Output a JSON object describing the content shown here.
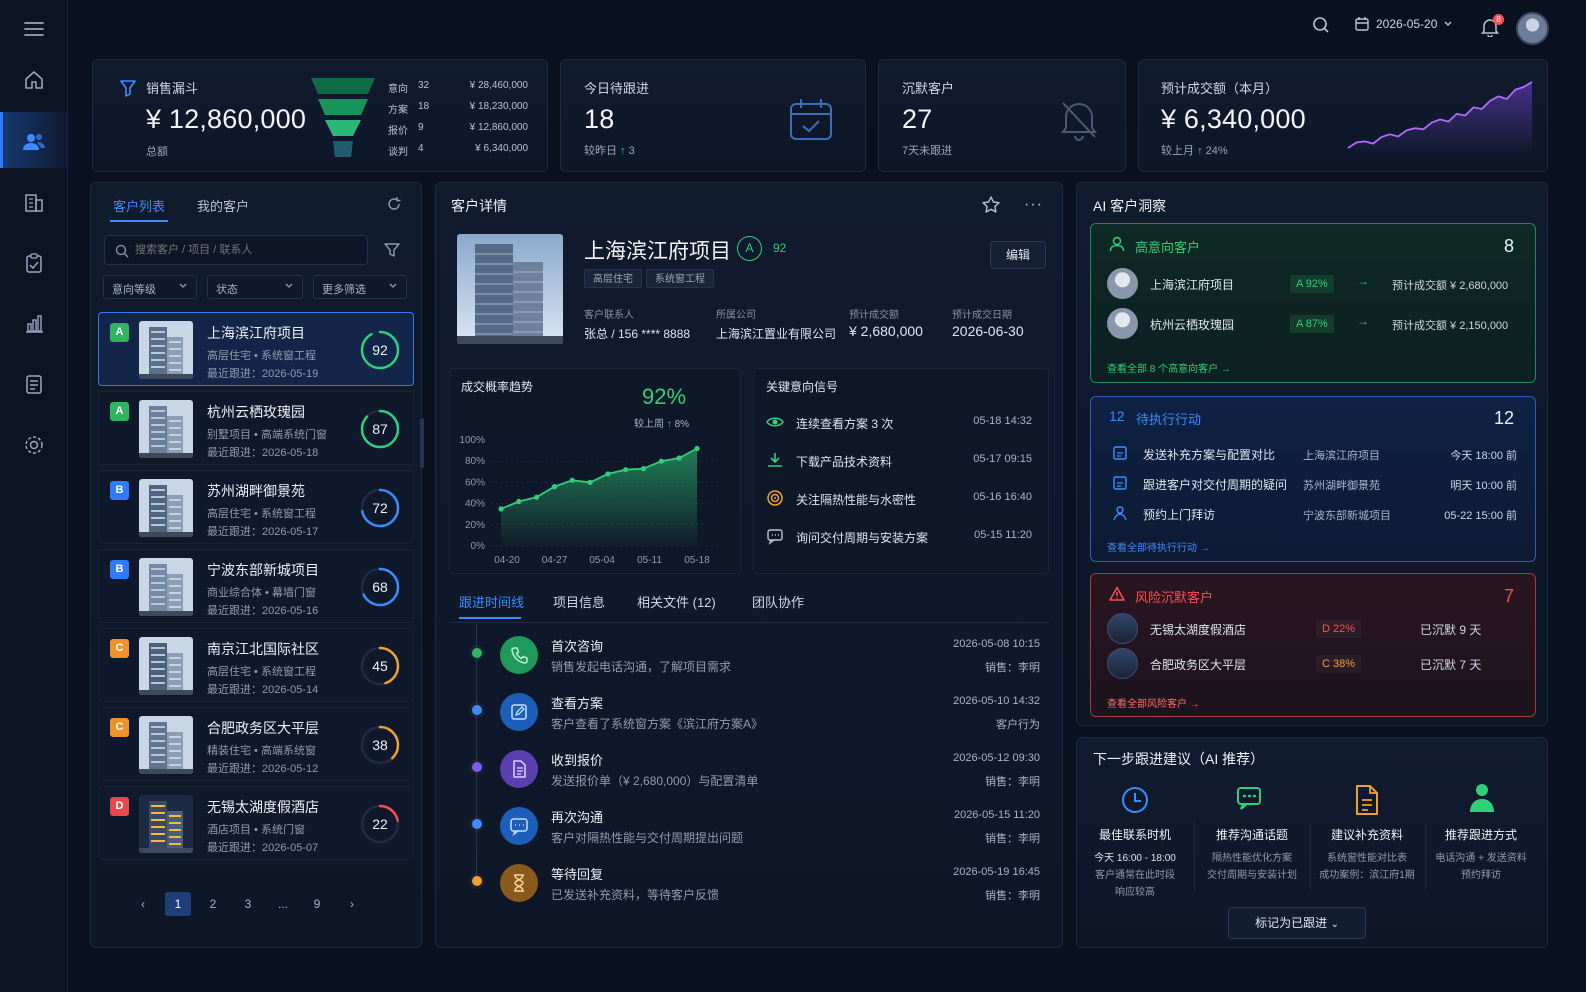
{
  "topbar": {
    "date": "2026-05-20",
    "notif_count": "8"
  },
  "stats": {
    "funnel": {
      "title": "销售漏斗",
      "value": "¥ 12,860,000",
      "sub": "总额",
      "stages": [
        {
          "label": "意向",
          "count": "32",
          "amount": "¥ 28,460,000"
        },
        {
          "label": "方案",
          "count": "18",
          "amount": "¥ 18,230,000"
        },
        {
          "label": "报价",
          "count": "9",
          "amount": "¥ 12,860,000"
        },
        {
          "label": "谈判",
          "count": "4",
          "amount": "¥ 6,340,000"
        }
      ],
      "colors": [
        "#0f6b45",
        "#17935c",
        "#2ab778",
        "#1f5c6e"
      ]
    },
    "today": {
      "title": "今日待跟进",
      "value": "18",
      "sub_label": "较昨日",
      "sub_delta": "3"
    },
    "silent": {
      "title": "沉默客户",
      "value": "27",
      "sub": "7天未跟进"
    },
    "forecast": {
      "title": "预计成交额（本月）",
      "value": "¥ 6,340,000",
      "sub_label": "较上月",
      "sub_delta": "24%",
      "spark": [
        2,
        3,
        3.2,
        2.8,
        4,
        4.5,
        4.1,
        5.2,
        5.6,
        5.4,
        6.6,
        7.2,
        6.8,
        8.2,
        7.9,
        9.4,
        9.1,
        10.6,
        11.4,
        10.9,
        12.6,
        13.1,
        14
      ]
    }
  },
  "list": {
    "tabs": [
      "客户列表",
      "我的客户"
    ],
    "search_placeholder": "搜索客户 / 项目 / 联系人",
    "filters": [
      "意向等级",
      "状态",
      "更多筛选"
    ],
    "customers": [
      {
        "grade": "A",
        "grade_color": "#2fb45f",
        "name": "上海滨江府项目",
        "type": "高层住宅 • 系统窗工程",
        "date": "最近跟进：2026-05-19",
        "score": 92,
        "score_color": "#2fd07a"
      },
      {
        "grade": "A",
        "grade_color": "#2fb45f",
        "name": "杭州云栖玫瑰园",
        "type": "别墅项目 • 高端系统门窗",
        "date": "最近跟进：2026-05-18",
        "score": 87,
        "score_color": "#2fd07a"
      },
      {
        "grade": "B",
        "grade_color": "#2f7bff",
        "name": "苏州湖畔御景苑",
        "type": "高层住宅 • 系统窗工程",
        "date": "最近跟进：2026-05-17",
        "score": 72,
        "score_color": "#3d8bff"
      },
      {
        "grade": "B",
        "grade_color": "#2f7bff",
        "name": "宁波东部新城项目",
        "type": "商业综合体 • 幕墙门窗",
        "date": "最近跟进：2026-05-16",
        "score": 68,
        "score_color": "#3d8bff"
      },
      {
        "grade": "C",
        "grade_color": "#f0922b",
        "name": "南京江北国际社区",
        "type": "高层住宅 • 系统窗工程",
        "date": "最近跟进：2026-05-14",
        "score": 45,
        "score_color": "#f0a030"
      },
      {
        "grade": "C",
        "grade_color": "#f0922b",
        "name": "合肥政务区大平层",
        "type": "精装住宅 • 高端系统窗",
        "date": "最近跟进：2026-05-12",
        "score": 38,
        "score_color": "#f0a030"
      },
      {
        "grade": "D",
        "grade_color": "#e5484d",
        "name": "无锡太湖度假酒店",
        "type": "酒店项目 • 系统门窗",
        "date": "最近跟进：2026-05-07",
        "score": 22,
        "score_color": "#ff4d4f"
      }
    ],
    "pages": [
      "1",
      "2",
      "3",
      "...",
      "9"
    ]
  },
  "detail": {
    "header": "客户详情",
    "name": "上海滨江府项目",
    "grade": "A",
    "score": "92",
    "tags": [
      "高层住宅",
      "系统窗工程"
    ],
    "edit_label": "编辑",
    "info": [
      {
        "label": "客户联系人",
        "value": "张总 / 156 **** 8888"
      },
      {
        "label": "所属公司",
        "value": "上海滨江置业有限公司"
      },
      {
        "label": "预计成交额",
        "value": "¥ 2,680,000"
      },
      {
        "label": "预计成交日期",
        "value": "2026-06-30"
      }
    ],
    "trend": {
      "title": "成交概率趋势",
      "value": "92%",
      "sub_label": "较上周",
      "sub_delta": "8%"
    },
    "signals_title": "关键意向信号",
    "signals": [
      {
        "text": "连续查看方案 3 次",
        "time": "05-18 14:32",
        "icon": "eye-icon"
      },
      {
        "text": "下载产品技术资料",
        "time": "05-17 09:15",
        "icon": "download-icon"
      },
      {
        "text": "关注隔热性能与水密性",
        "time": "05-16 16:40",
        "icon": "target-icon"
      },
      {
        "text": "询问交付周期与安装方案",
        "time": "05-15 11:20",
        "icon": "chat-icon"
      }
    ],
    "tabs": [
      "跟进时间线",
      "项目信息",
      "相关文件 (12)",
      "团队协作"
    ],
    "timeline": [
      {
        "title": "首次咨询",
        "desc": "销售发起电话沟通，了解项目需求",
        "time": "2026-05-08 10:15",
        "who": "销售：李明",
        "color": "#1f9a5a",
        "dot": "#2fb45f",
        "icon": "phone-icon"
      },
      {
        "title": "查看方案",
        "desc": "客户查看了系统窗方案《滨江府方案A》",
        "time": "2026-05-10 14:32",
        "who": "客户行为",
        "color": "#1d5fb8",
        "dot": "#3d8bff",
        "icon": "doc-edit-icon"
      },
      {
        "title": "收到报价",
        "desc": "发送报价单（¥ 2,680,000）与配置清单",
        "time": "2026-05-12 09:30",
        "who": "销售：李明",
        "color": "#5a3fb0",
        "dot": "#7c5cff",
        "icon": "document-icon"
      },
      {
        "title": "再次沟通",
        "desc": "客户对隔热性能与交付周期提出问题",
        "time": "2026-05-15 11:20",
        "who": "销售：李明",
        "color": "#1d5fb8",
        "dot": "#3d8bff",
        "icon": "chat-icon"
      },
      {
        "title": "等待回复",
        "desc": "已发送补充资料，等待客户反馈",
        "time": "2026-05-19 16:45",
        "who": "销售：李明",
        "color": "#8a5a1c",
        "dot": "#f0a030",
        "icon": "hourglass-icon"
      }
    ]
  },
  "chart_data": {
    "type": "area",
    "title": "成交概率趋势",
    "x_ticks": [
      "04-20",
      "04-27",
      "05-04",
      "05-11",
      "05-18"
    ],
    "y_ticks": [
      "0%",
      "20%",
      "40%",
      "60%",
      "80%",
      "100%"
    ],
    "ylim": [
      0,
      100
    ],
    "values": [
      35,
      42,
      46,
      56,
      62,
      60,
      68,
      72,
      73,
      80,
      83,
      92
    ],
    "color": "#2fd07a"
  },
  "ai": {
    "title": "AI 客户洞察",
    "high": {
      "title": "高意向客户",
      "count": "8",
      "items": [
        {
          "name": "上海滨江府项目",
          "grade": "A",
          "pct": "92%",
          "value": "预计成交额 ¥ 2,680,000"
        },
        {
          "name": "杭州云栖玫瑰园",
          "grade": "A",
          "pct": "87%",
          "value": "预计成交额 ¥ 2,150,000"
        }
      ],
      "link": "查看全部 8 个高意向客户"
    },
    "actions": {
      "title_num": "12",
      "title": "待执行行动",
      "count": "12",
      "items": [
        {
          "task": "发送补充方案与配置对比",
          "project": "上海滨江府项目",
          "time": "今天 18:00 前"
        },
        {
          "task": "跟进客户对交付周期的疑问",
          "project": "苏州湖畔御景苑",
          "time": "明天 10:00 前"
        },
        {
          "task": "预约上门拜访",
          "project": "宁波东部新城项目",
          "time": "05-22 15:00 前"
        }
      ],
      "link": "查看全部待执行行动"
    },
    "risk": {
      "title": "风险沉默客户",
      "count": "7",
      "items": [
        {
          "name": "无锡太湖度假酒店",
          "grade": "D",
          "pct": "22%",
          "silent": "已沉默 9 天",
          "color": "#ff4d4f"
        },
        {
          "name": "合肥政务区大平层",
          "grade": "C",
          "pct": "38%",
          "silent": "已沉默 7 天",
          "color": "#f0a030"
        }
      ],
      "link": "查看全部风险客户"
    }
  },
  "next": {
    "title": "下一步跟进建议（AI 推荐）",
    "items": [
      {
        "title": "最佳联系时机",
        "desc1": "今天 16:00 - 18:00",
        "desc2": "客户通常在此时段",
        "desc3": "响应较高"
      },
      {
        "title": "推荐沟通话题",
        "desc1": "隔热性能优化方案",
        "desc2": "交付周期与安装计划",
        "desc3": ""
      },
      {
        "title": "建议补充资料",
        "desc1": "系统窗性能对比表",
        "desc2": "成功案例：滨江府1期",
        "desc3": ""
      },
      {
        "title": "推荐跟进方式",
        "desc1": "电话沟通 + 发送资料",
        "desc2": "预约拜访",
        "desc3": ""
      }
    ],
    "button": "标记为已跟进"
  }
}
